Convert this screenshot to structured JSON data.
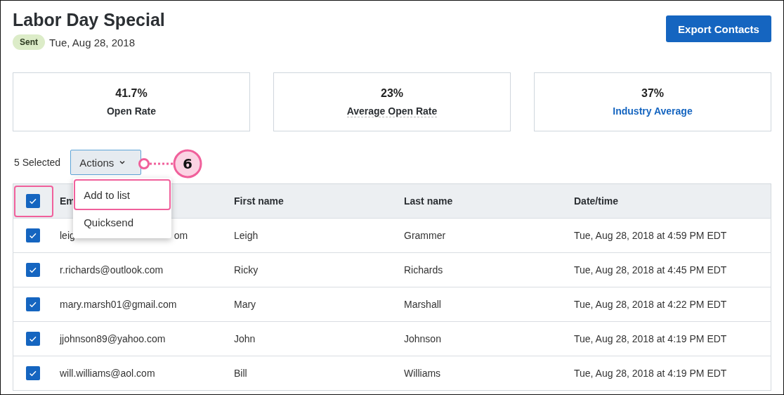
{
  "title": "Labor Day Special",
  "status": {
    "label": "Sent",
    "date": "Tue, Aug 28, 2018"
  },
  "export_button": "Export Contacts",
  "stats": [
    {
      "value": "41.7%",
      "label": "Open Rate",
      "kind": "plain"
    },
    {
      "value": "23%",
      "label": "Average Open Rate",
      "kind": "dotted"
    },
    {
      "value": "37%",
      "label": "Industry Average",
      "kind": "link"
    }
  ],
  "toolbar": {
    "selected_count": "5 Selected",
    "actions": {
      "label": "Actions",
      "expanded": true,
      "menu": [
        {
          "label": "Add to list",
          "highlighted": true
        },
        {
          "label": "Quicksend",
          "highlighted": false
        }
      ]
    }
  },
  "callout": {
    "number": "6"
  },
  "table": {
    "select_all": {
      "checked": true,
      "highlighted": true
    },
    "columns": [
      "Em",
      "First name",
      "Last name",
      "Date/time"
    ],
    "rows": [
      {
        "checked": true,
        "email": "leig",
        "email_tail": "om",
        "first": "Leigh",
        "last": "Grammer",
        "date": "Tue, Aug 28, 2018 at 4:59 PM EDT"
      },
      {
        "checked": true,
        "email": "r.richards@outlook.com",
        "first": "Ricky",
        "last": "Richards",
        "date": "Tue, Aug 28, 2018 at 4:45 PM EDT"
      },
      {
        "checked": true,
        "email": "mary.marsh01@gmail.com",
        "first": "Mary",
        "last": "Marshall",
        "date": "Tue, Aug 28, 2018 at 4:22 PM EDT"
      },
      {
        "checked": true,
        "email": "jjohnson89@yahoo.com",
        "first": "John",
        "last": "Johnson",
        "date": "Tue, Aug 28, 2018 at 4:19 PM EDT"
      },
      {
        "checked": true,
        "email": "will.williams@aol.com",
        "first": "Bill",
        "last": "Williams",
        "date": "Tue, Aug 28, 2018 at 4:19 PM EDT"
      }
    ]
  }
}
